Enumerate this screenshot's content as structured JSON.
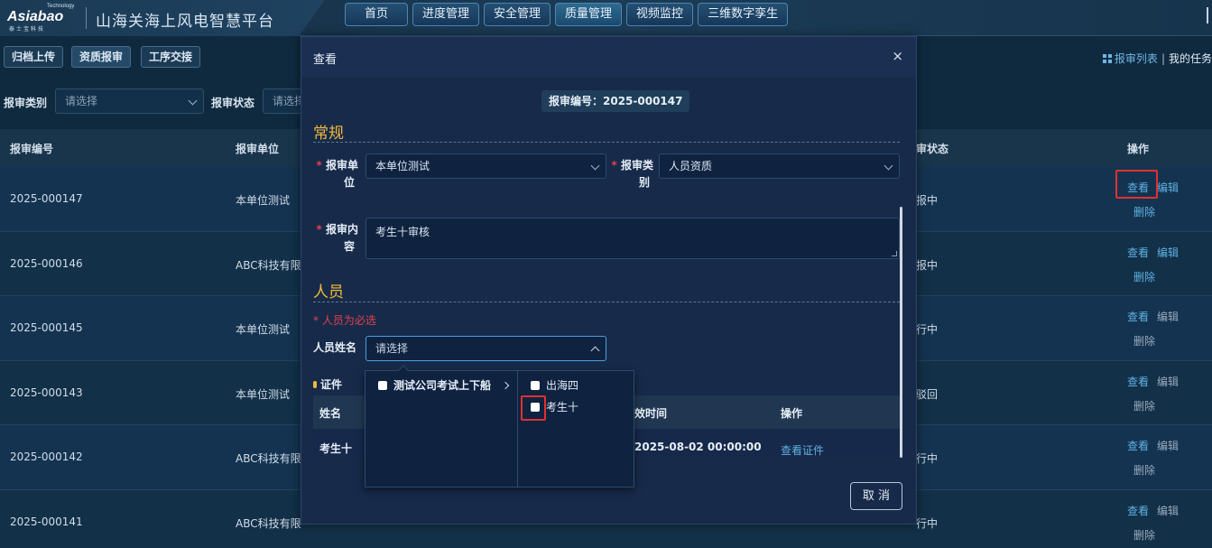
{
  "header": {
    "logo_mark": "Asiabao",
    "logo_tech": "Technology",
    "logo_sub": "泰士宝科技",
    "app_title": "山海关海上风电智慧平台",
    "nav": [
      "首页",
      "进度管理",
      "安全管理",
      "质量管理",
      "视频监控",
      "三维数字孪生"
    ]
  },
  "subnav": {
    "buttons": [
      "归档上传",
      "资质报审",
      "工序交接"
    ],
    "list_link": "报审列表",
    "sep": "|",
    "my_tasks": "我的任务"
  },
  "filters": {
    "type_label": "报审类别",
    "type_placeholder": "请选择",
    "status_label": "报审状态",
    "status_placeholder": "请选择"
  },
  "table": {
    "headers": {
      "code": "报审编号",
      "unit": "报审单位",
      "status": "审状态",
      "ops": "操作"
    },
    "rows": [
      {
        "code": "2025-000147",
        "unit": "本单位测试",
        "status": "报中",
        "edit_active": true
      },
      {
        "code": "2025-000146",
        "unit": "ABC科技有限",
        "status": "报中",
        "edit_active": true
      },
      {
        "code": "2025-000145",
        "unit": "本单位测试",
        "status": "行中",
        "edit_active": false
      },
      {
        "code": "2025-000143",
        "unit": "本单位测试",
        "status": "驳回",
        "edit_active": false
      },
      {
        "code": "2025-000142",
        "unit": "ABC科技有限",
        "status": "行中",
        "edit_active": false
      },
      {
        "code": "2025-000141",
        "unit": "ABC科技有限",
        "status": "行中",
        "edit_active": false
      }
    ],
    "op_view": "查看",
    "op_edit": "编辑",
    "op_delete": "删除"
  },
  "modal": {
    "title": "查看",
    "close": "×",
    "code_badge": "报审编号：2025-000147",
    "section_general": "常规",
    "unit_label_1": "报审单",
    "unit_label_2": "位",
    "unit_value": "本单位测试",
    "type_label_1": "报审类",
    "type_label_2": "别",
    "type_value": "人员资质",
    "content_label_1": "报审内",
    "content_label_2": "容",
    "content_value": "考生十审核",
    "section_people": "人员",
    "people_hint": "* 人员为必选",
    "name_label": "人员姓名",
    "name_placeholder": "请选择",
    "cert_label": "证件",
    "inner_headers": {
      "name": "姓名",
      "expire": "效时间",
      "op": "操作"
    },
    "inner_row": {
      "name": "考生十",
      "expire": "2025-08-02 00:00:00",
      "op": "查看证件"
    },
    "cancel": "取 消"
  },
  "cascader": {
    "level1": [
      {
        "label": "测试公司考试上下船",
        "has_children": true
      }
    ],
    "level2": [
      {
        "label": "出海四"
      },
      {
        "label": "考生十"
      }
    ]
  },
  "colors": {
    "accent": "#5fb1e2",
    "section": "#f0b93a",
    "required": "#e5424a",
    "highlight": "#e0312f"
  }
}
